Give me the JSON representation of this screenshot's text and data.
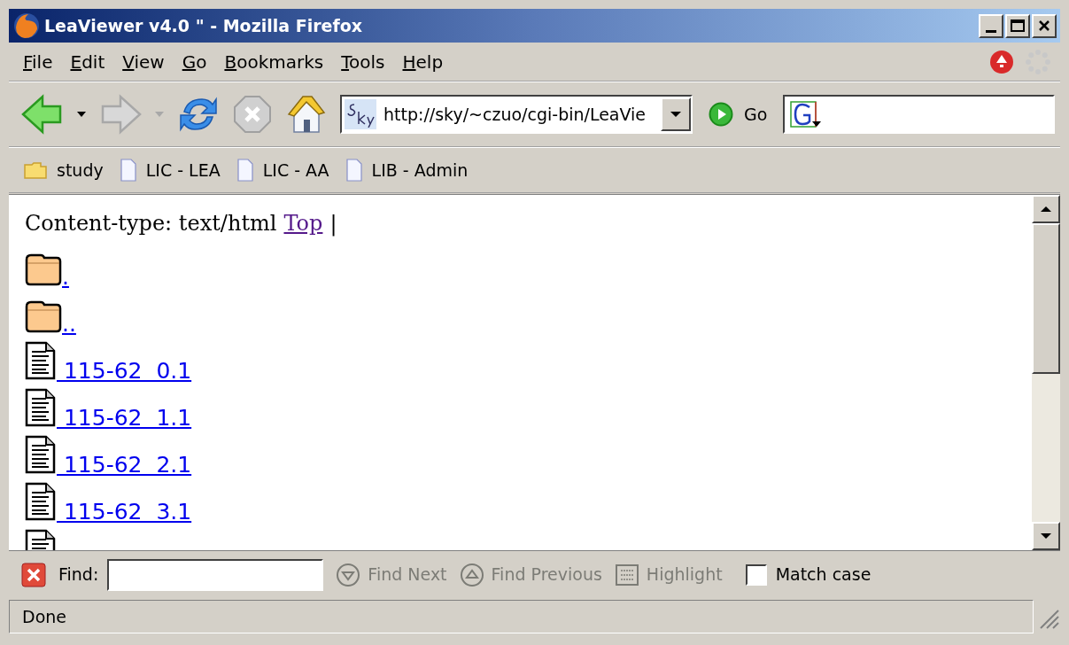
{
  "window": {
    "title": "LeaViewer v4.0 \" - Mozilla Firefox"
  },
  "menu": [
    "File",
    "Edit",
    "View",
    "Go",
    "Bookmarks",
    "Tools",
    "Help"
  ],
  "navigation": {
    "forward_disabled": true,
    "stop_disabled": true,
    "url": "http://sky/~czuo/cgi-bin/LeaVie",
    "go_label": "Go"
  },
  "bookmarks": [
    {
      "label": "study",
      "kind": "folder"
    },
    {
      "label": "LIC - LEA",
      "kind": "page"
    },
    {
      "label": "LIC - AA",
      "kind": "page"
    },
    {
      "label": "LIB - Admin",
      "kind": "page"
    }
  ],
  "content": {
    "header": "Content-type: text/html",
    "top_link": "Top",
    "separator": "|",
    "entries": [
      {
        "label": ".",
        "kind": "folder"
      },
      {
        "label": "..",
        "kind": "folder"
      },
      {
        "label": " 115-62  0.1",
        "kind": "file"
      },
      {
        "label": " 115-62  1.1",
        "kind": "file"
      },
      {
        "label": " 115-62  2.1",
        "kind": "file"
      },
      {
        "label": " 115-62  3.1",
        "kind": "file"
      },
      {
        "kind": "file"
      }
    ]
  },
  "find_bar": {
    "label": "Find:",
    "find_next": "Find Next",
    "find_previous": "Find Previous",
    "highlight": "Highlight",
    "match_case": {
      "label": "Match case",
      "checked": false
    },
    "buttons_disabled": true
  },
  "status_bar": {
    "text": "Done"
  }
}
